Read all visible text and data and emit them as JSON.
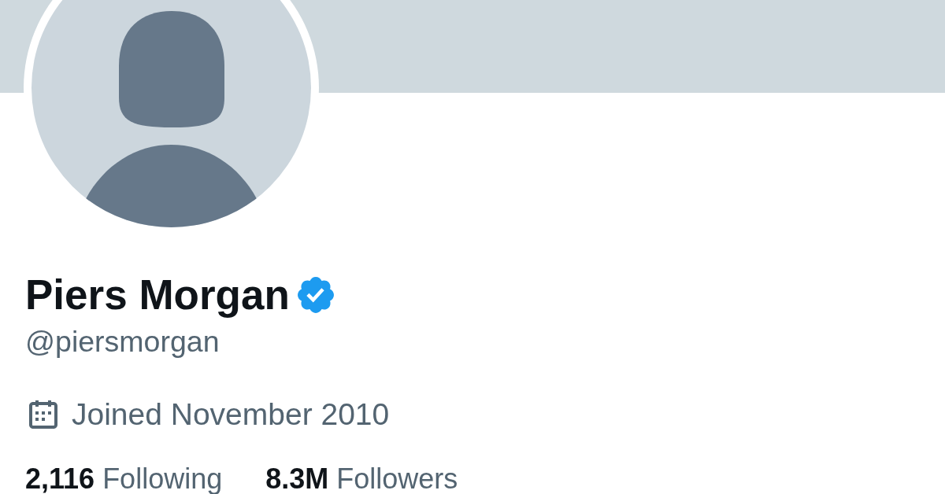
{
  "profile": {
    "name": "Piers Morgan",
    "verified": true,
    "handle": "@piersmorgan",
    "joined": "Joined November 2010",
    "stats": [
      {
        "count": "2,116",
        "label": "Following"
      },
      {
        "count": "8.3M",
        "label": "Followers"
      }
    ]
  }
}
